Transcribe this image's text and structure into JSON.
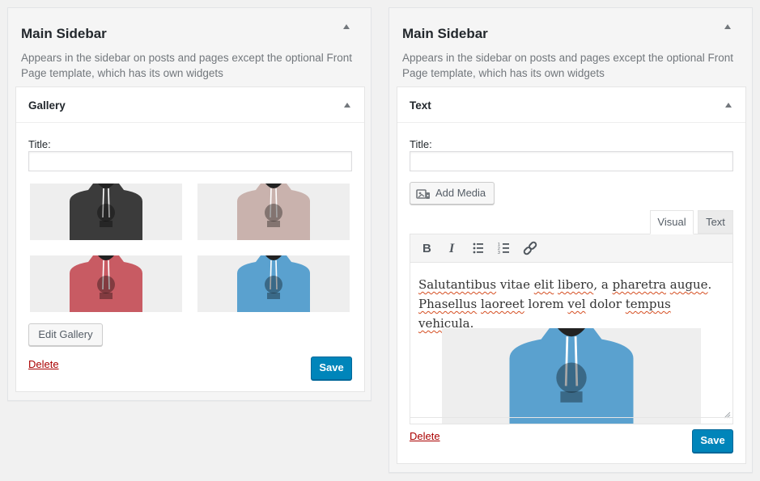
{
  "left_panel": {
    "title": "Main Sidebar",
    "description": "Appears in the sidebar on posts and pages except the optional Front Page template, which has its own widgets",
    "widget": {
      "title": "Gallery",
      "title_label": "Title:",
      "title_value": "",
      "images": [
        {
          "alt": "dark gray hoodie",
          "color": "#3b3b3b"
        },
        {
          "alt": "beige hoodie",
          "color": "#c9b2ad"
        },
        {
          "alt": "red hoodie",
          "color": "#c85b63"
        },
        {
          "alt": "blue hoodie",
          "color": "#5aa1cf"
        }
      ],
      "edit_gallery_label": "Edit Gallery",
      "delete_label": "Delete",
      "save_label": "Save"
    }
  },
  "right_panel": {
    "title": "Main Sidebar",
    "description": "Appears in the sidebar on posts and pages except the optional Front Page template, which has its own widgets",
    "widget": {
      "title": "Text",
      "title_label": "Title:",
      "title_value": "",
      "add_media_label": "Add Media",
      "tabs": {
        "visual": "Visual",
        "text": "Text",
        "active": "Visual"
      },
      "toolbar": [
        "bold",
        "italic",
        "bullet-list",
        "numbered-list",
        "link"
      ],
      "content": {
        "w1": "Salutantibus",
        "w2": " vitae ",
        "w3": "elit",
        "w4": " ",
        "w5": "libero",
        "w6": ", a ",
        "w7": "pharetra",
        "w8": " ",
        "w9": "augue",
        "w10": ". ",
        "w11": "Phasellus",
        "w12": " ",
        "w13": "laoreet",
        "w14": " ",
        "w15": "lorem",
        "w16": " ",
        "w17": "vel",
        "w18": " dolor ",
        "w19": "tempus",
        "w20": " ",
        "w21": "vehicula",
        "w22": "."
      },
      "image": {
        "alt": "blue hoodie",
        "color": "#5aa1cf"
      },
      "delete_label": "Delete",
      "save_label": "Save"
    }
  },
  "colors": {
    "accent": "#0085ba",
    "delete": "#aa0000",
    "spellcheck": "#d54e21"
  }
}
